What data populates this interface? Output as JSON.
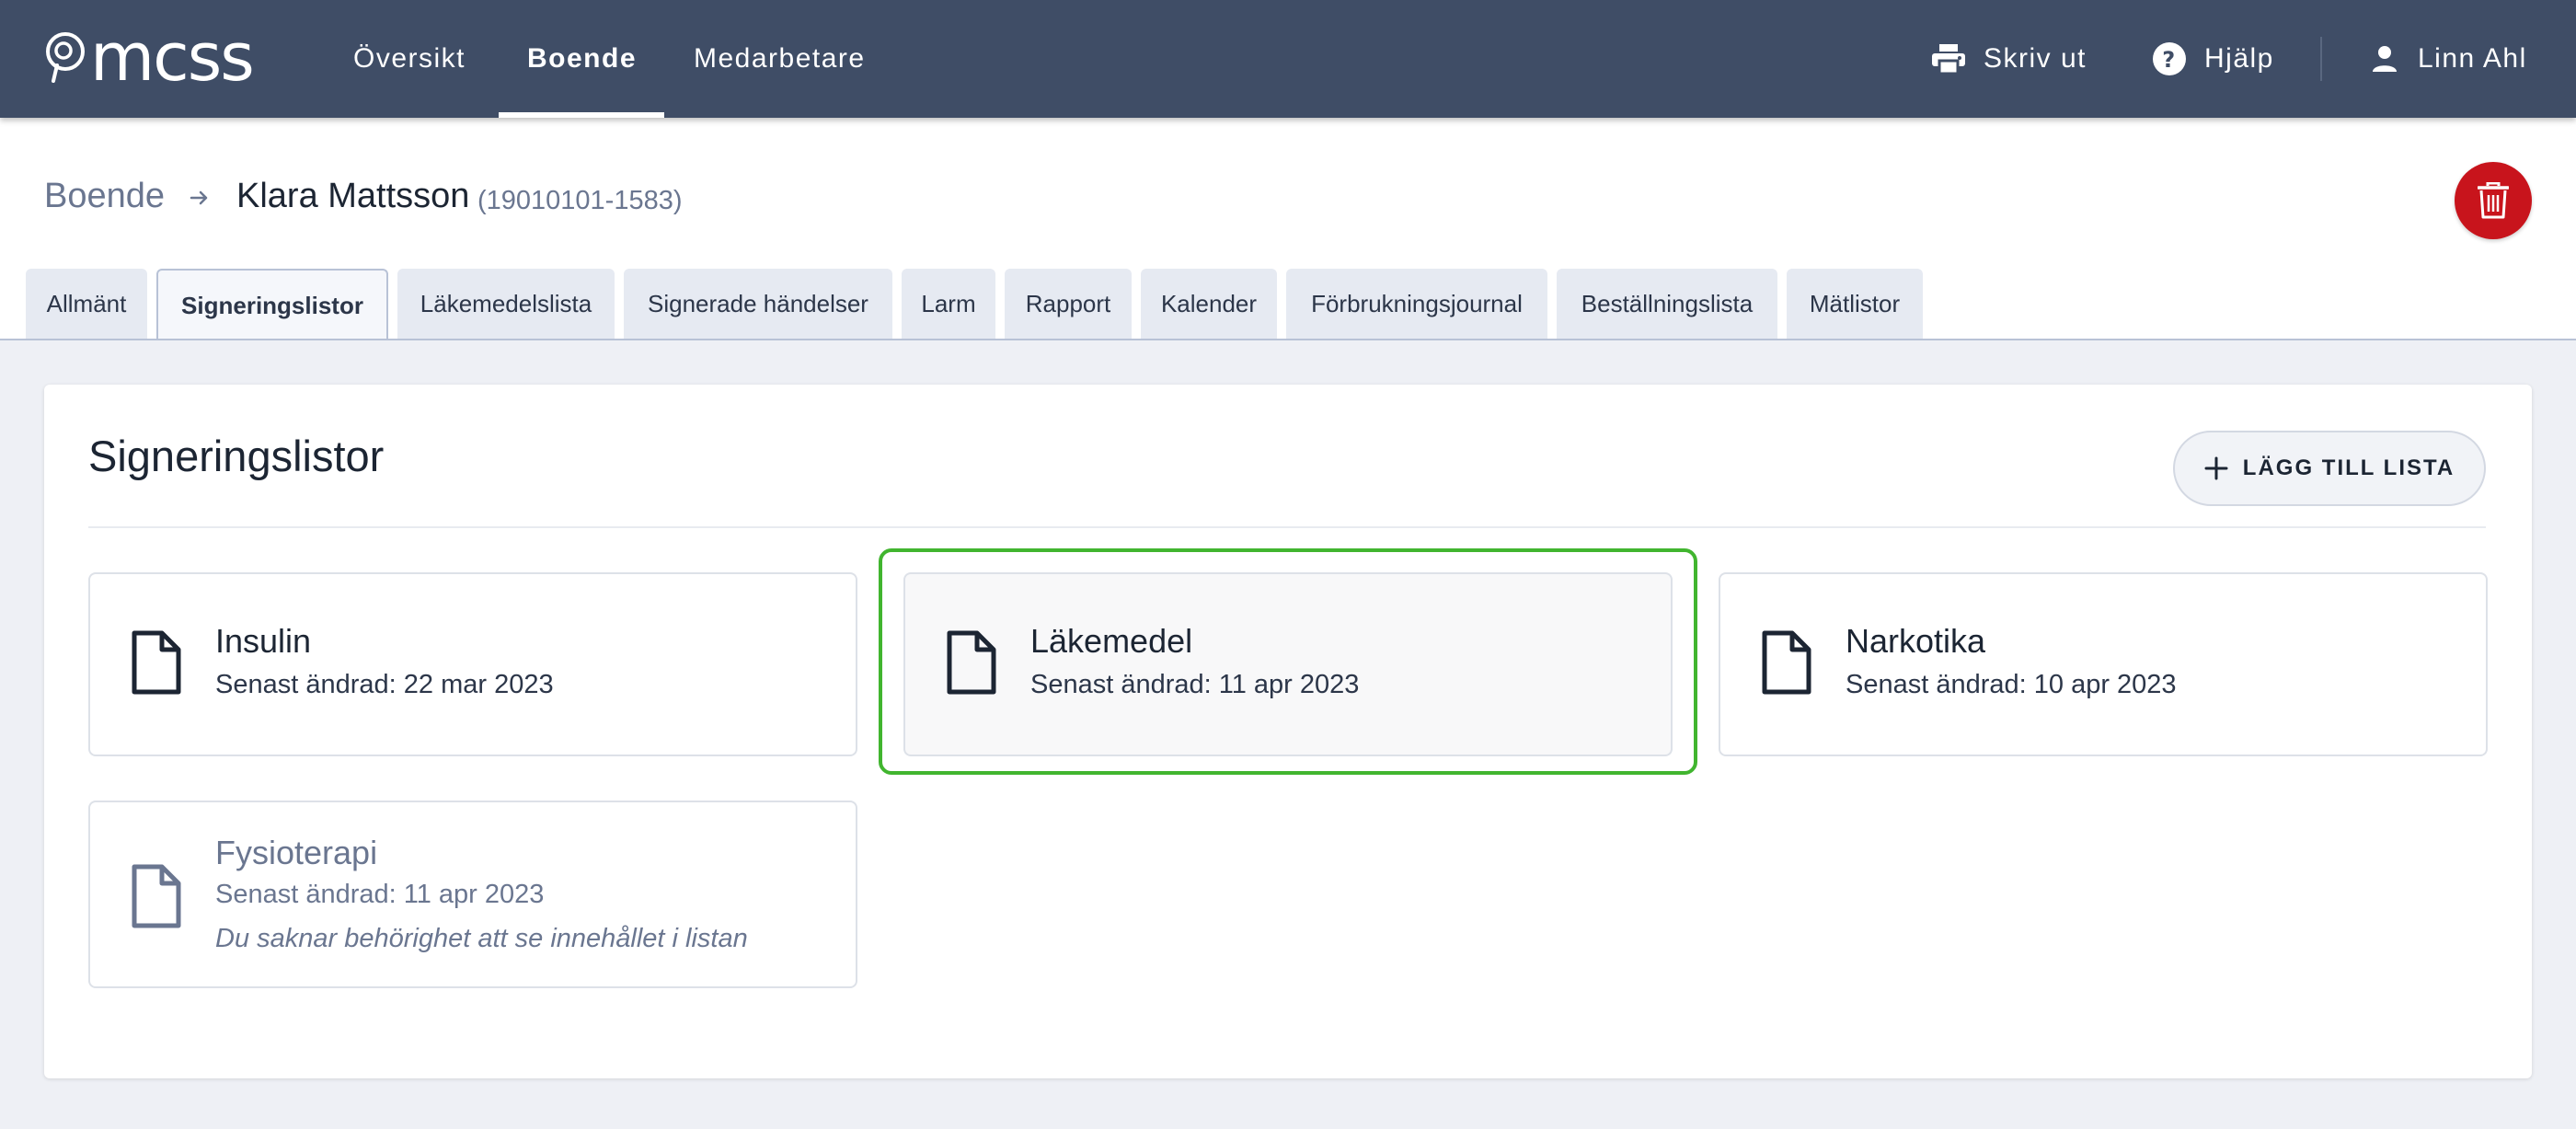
{
  "app": {
    "logo_text": "mcss",
    "nav": {
      "items": [
        {
          "label": "Översikt"
        },
        {
          "label": "Boende"
        },
        {
          "label": "Medarbetare"
        }
      ],
      "print_label": "Skriv ut",
      "help_label": "Hjälp",
      "user_name": "Linn Ahl"
    }
  },
  "header": {
    "breadcrumb_root": "Boende",
    "patient_name": "Klara Mattsson",
    "patient_id": "(19010101-1583)"
  },
  "tabs": [
    {
      "label": "Allmänt"
    },
    {
      "label": "Signeringslistor"
    },
    {
      "label": "Läkemedelslista"
    },
    {
      "label": "Signerade händelser"
    },
    {
      "label": "Larm"
    },
    {
      "label": "Rapport"
    },
    {
      "label": "Kalender"
    },
    {
      "label": "Förbrukningsjournal"
    },
    {
      "label": "Beställningslista"
    },
    {
      "label": "Mätlistor"
    }
  ],
  "main": {
    "title": "Signeringslistor",
    "add_button_label": "LÄGG TILL LISTA",
    "lists": [
      {
        "name": "Insulin",
        "modified": "Senast ändrad: 22 mar 2023"
      },
      {
        "name": "Läkemedel",
        "modified": "Senast ändrad: 11 apr 2023"
      },
      {
        "name": "Narkotika",
        "modified": "Senast ändrad: 10 apr 2023"
      },
      {
        "name": "Fysioterapi",
        "modified": "Senast ändrad: 11 apr 2023",
        "note": "Du saknar behörighet att se innehållet i listan"
      }
    ]
  },
  "colors": {
    "nav_bg": "#3f4d66",
    "delete_red": "#c8141c",
    "highlight_green": "#41b52f",
    "page_bg": "#eef0f5"
  },
  "icons": [
    "logo-icon",
    "printer-icon",
    "help-icon",
    "user-icon",
    "arrow-right-icon",
    "trash-icon",
    "plus-icon",
    "document-icon"
  ]
}
